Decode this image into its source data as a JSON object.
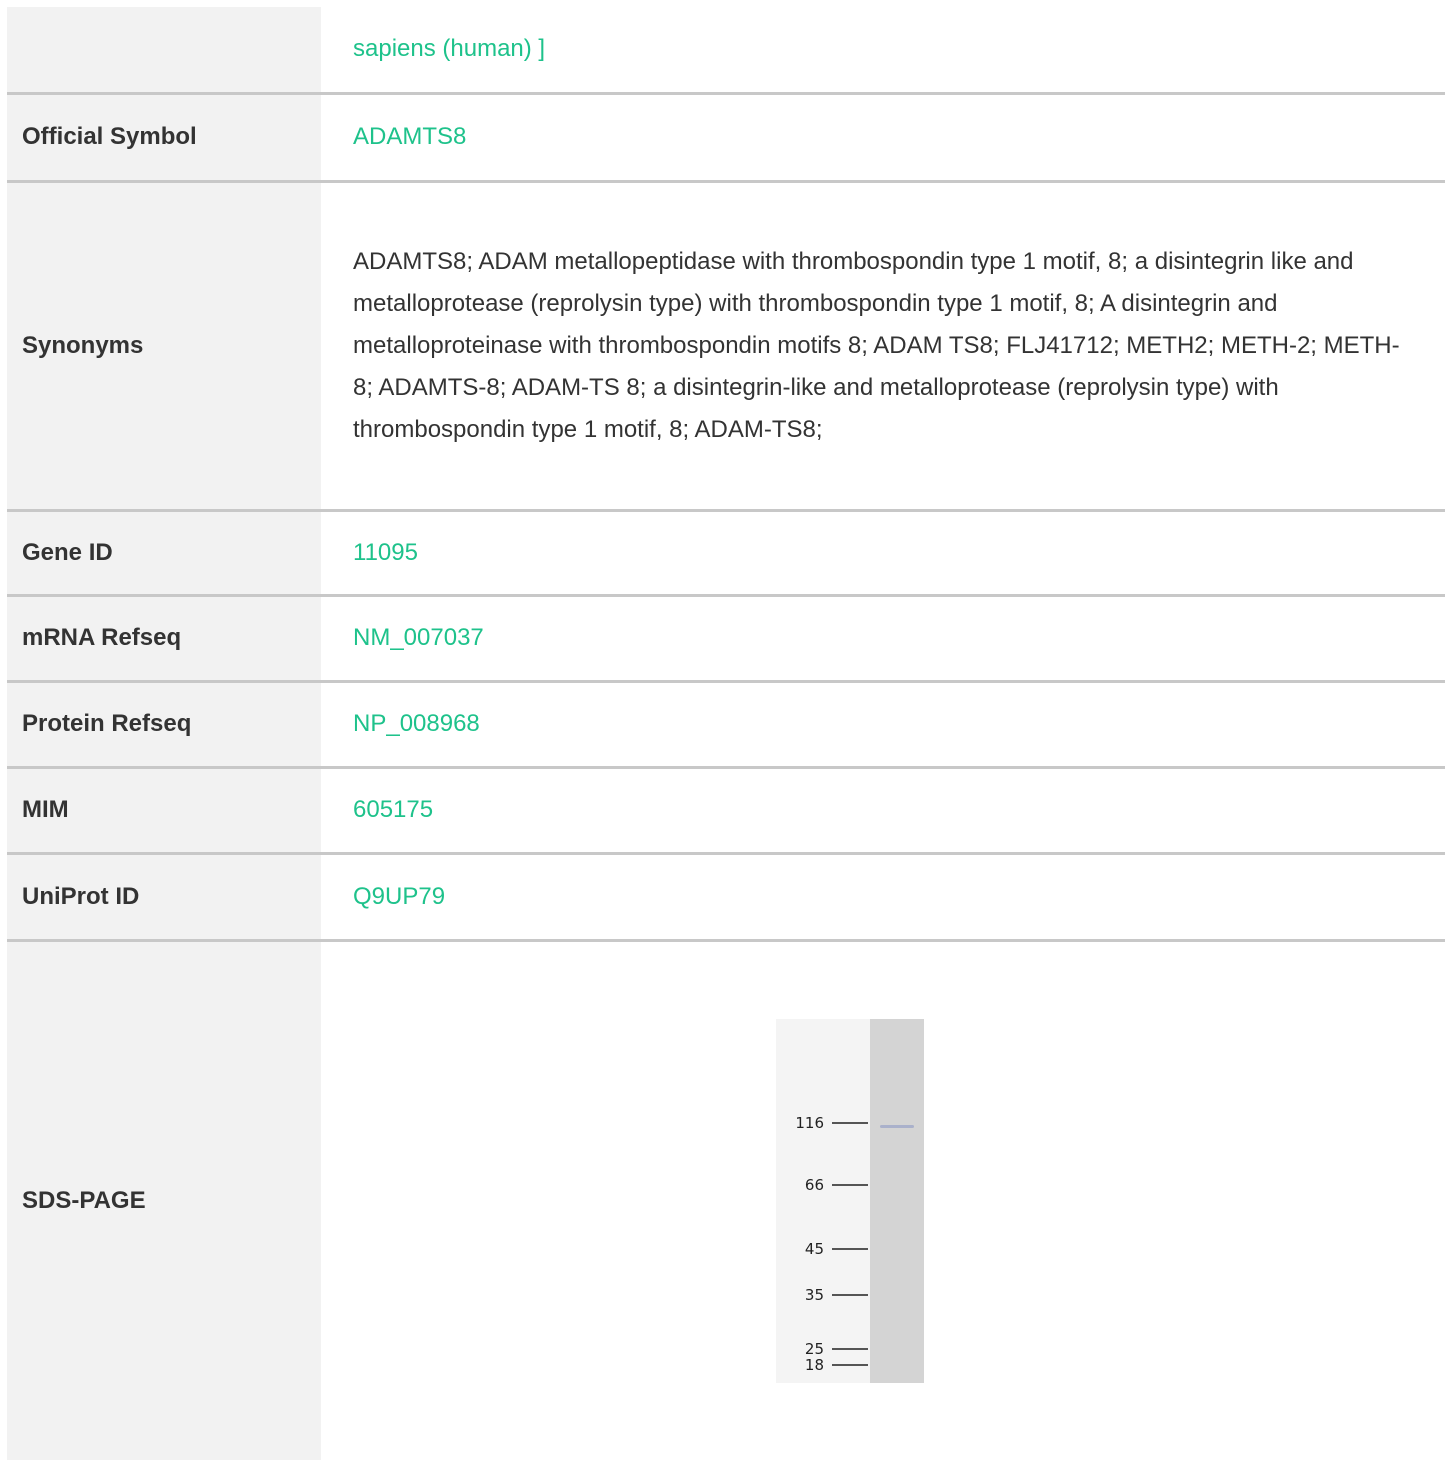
{
  "rows": {
    "organism": {
      "label": "",
      "value": "sapiens (human) ]"
    },
    "official_symbol": {
      "label": "Official Symbol",
      "value": "ADAMTS8"
    },
    "synonyms": {
      "label": "Synonyms",
      "value": "ADAMTS8; ADAM metallopeptidase with thrombospondin type 1 motif, 8; a disintegrin like and metalloprotease (reprolysin type) with thrombospondin type 1 motif, 8; A disintegrin and metalloproteinase with thrombospondin motifs 8; ADAM TS8; FLJ41712; METH2; METH-2; METH-8; ADAMTS-8; ADAM-TS 8; a disintegrin-like and metalloprotease (reprolysin type) with thrombospondin type 1 motif, 8; ADAM-TS8;"
    },
    "gene_id": {
      "label": "Gene ID",
      "value": "11095"
    },
    "mrna_refseq": {
      "label": "mRNA Refseq",
      "value": "NM_007037"
    },
    "protein_refseq": {
      "label": "Protein Refseq",
      "value": "NP_008968"
    },
    "mim": {
      "label": "MIM",
      "value": "605175"
    },
    "uniprot_id": {
      "label": "UniProt ID",
      "value": "Q9UP79"
    },
    "sds_page": {
      "label": "SDS-PAGE",
      "markers": [
        "116",
        "66",
        "45",
        "35",
        "25",
        "18"
      ]
    }
  },
  "colors": {
    "link": "#1ec28b",
    "label_bg": "#f2f2f2",
    "divider": "#c8c8c8",
    "text": "#333333"
  }
}
